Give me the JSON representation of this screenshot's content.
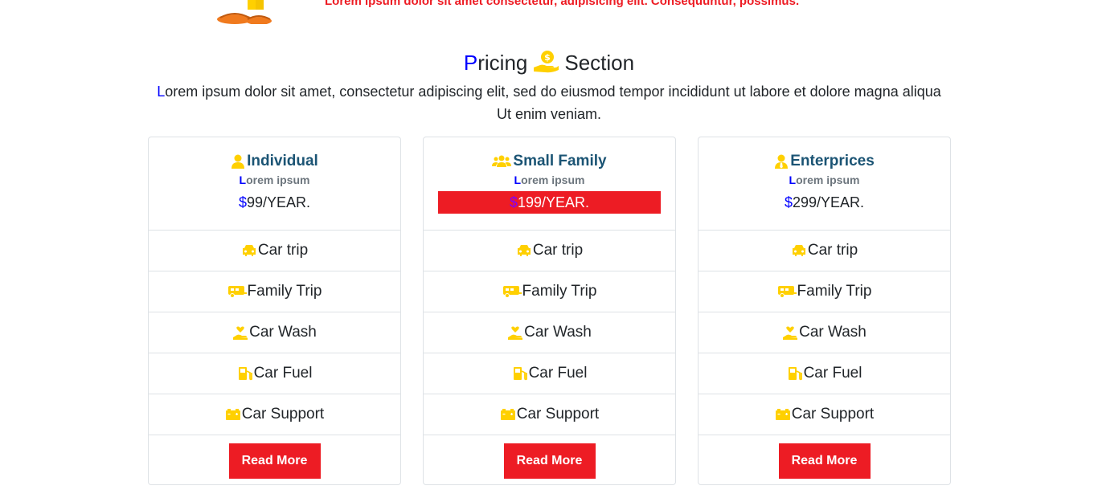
{
  "top": {
    "text": "Lorem ipsum dolor sit amet consectetur, adipisicing elit. Consequuntur, possimus."
  },
  "section": {
    "title_first": "P",
    "title_rest": "ricing",
    "title_end": "Section",
    "desc_first": "L",
    "desc_rest": "orem ipsum dolor sit amet, consectetur adipiscing elit, sed do eiusmod tempor incididunt ut labore et dolore magna aliqua Ut enim veniam."
  },
  "colors": {
    "accent": "#ed1c24",
    "icon": "#ffd000",
    "plan_name": "#1b5474",
    "first_letter": "#0000ff"
  },
  "plans": [
    {
      "name": "Individual",
      "icon": "user-icon",
      "sub_first": "L",
      "sub_rest": "orem ipsum",
      "price_symbol": "$",
      "price": "99/YEAR.",
      "highlighted": false,
      "features": [
        {
          "icon": "car-icon",
          "label": "Car trip"
        },
        {
          "icon": "rv-icon",
          "label": "Family Trip"
        },
        {
          "icon": "hand-heart-icon",
          "label": "Car Wash"
        },
        {
          "icon": "gas-pump-icon",
          "label": "Car Fuel"
        },
        {
          "icon": "battery-icon",
          "label": "Car Support"
        }
      ],
      "button": "Read More"
    },
    {
      "name": "Small Family",
      "icon": "users-icon",
      "sub_first": "L",
      "sub_rest": "orem ipsum",
      "price_symbol": "$",
      "price": "199/YEAR.",
      "highlighted": true,
      "features": [
        {
          "icon": "car-icon",
          "label": "Car trip"
        },
        {
          "icon": "rv-icon",
          "label": "Family Trip"
        },
        {
          "icon": "hand-heart-icon",
          "label": "Car Wash"
        },
        {
          "icon": "gas-pump-icon",
          "label": "Car Fuel"
        },
        {
          "icon": "battery-icon",
          "label": "Car Support"
        }
      ],
      "button": "Read More"
    },
    {
      "name": "Enterprices",
      "icon": "user-tie-icon",
      "sub_first": "L",
      "sub_rest": "orem ipsum",
      "price_symbol": "$",
      "price": "299/YEAR.",
      "highlighted": false,
      "features": [
        {
          "icon": "car-icon",
          "label": "Car trip"
        },
        {
          "icon": "rv-icon",
          "label": "Family Trip"
        },
        {
          "icon": "hand-heart-icon",
          "label": "Car Wash"
        },
        {
          "icon": "gas-pump-icon",
          "label": "Car Fuel"
        },
        {
          "icon": "battery-icon",
          "label": "Car Support"
        }
      ],
      "button": "Read More"
    }
  ]
}
